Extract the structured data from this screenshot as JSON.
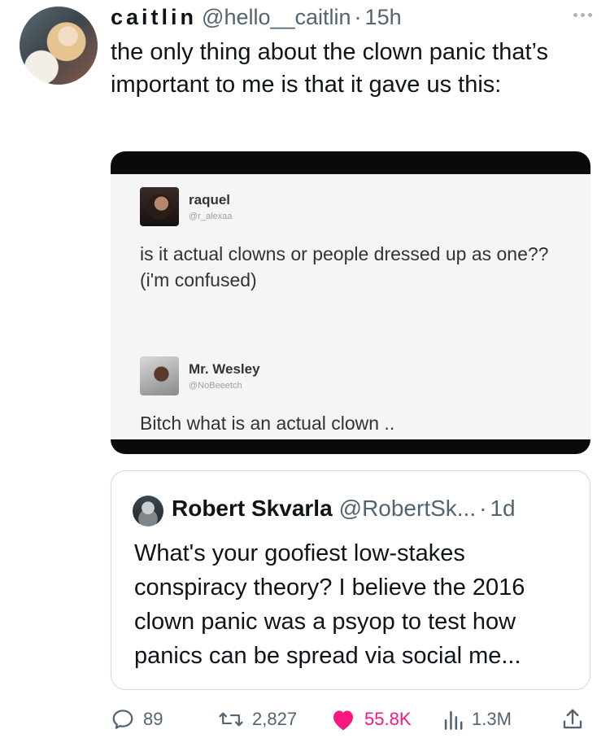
{
  "tweet": {
    "display_name": "caitlin",
    "handle": "@hello__caitlin",
    "separator": "·",
    "time": "15h",
    "text": "the only thing about the clown panic that’s important to me is that it gave us this:"
  },
  "media": {
    "post1": {
      "name": "raquel",
      "handle": "@r_alexaa",
      "text": "is it actual clowns or people dressed up as one?? (i'm confused)"
    },
    "post2": {
      "name": "Mr. Wesley",
      "handle": "@NoBeeetch",
      "text": "Bitch what is an actual clown .."
    }
  },
  "quote": {
    "name": "Robert Skvarla",
    "handle": "@RobertSk...",
    "separator": "·",
    "time": "1d",
    "text": "What's your goofiest low-stakes conspiracy theory? I believe the 2016 clown panic was a psyop to test how panics can be spread via social me..."
  },
  "actions": {
    "replies": "89",
    "reposts": "2,827",
    "likes": "55.8K",
    "views": "1.3M"
  },
  "icons": {
    "reply": "reply-icon",
    "repost": "repost-icon",
    "like": "heart-icon",
    "views": "views-icon",
    "share": "share-icon",
    "more": "more-icon"
  },
  "colors": {
    "text": "#0f1419",
    "secondary": "#536471",
    "like": "#f91880",
    "border": "#cfd9de"
  }
}
